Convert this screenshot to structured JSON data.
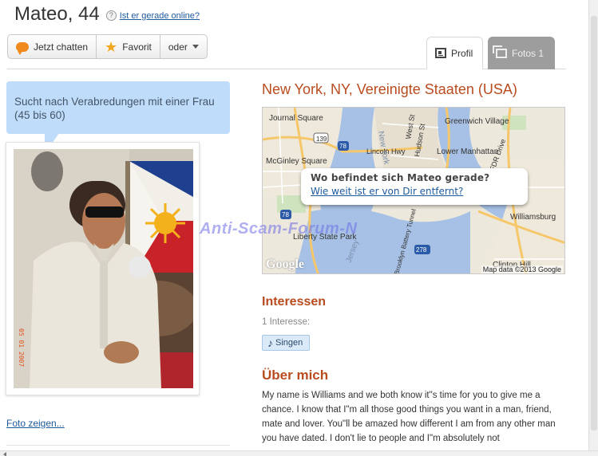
{
  "header": {
    "title": "Mateo, 44",
    "help_glyph": "?",
    "online_link": "Ist er gerade online?"
  },
  "actions": {
    "chat_label": "Jetzt chatten",
    "favorite_label": "Favorit",
    "more_label": "oder"
  },
  "tabs": [
    {
      "label": "Profil",
      "active": true
    },
    {
      "label": "Fotos 1",
      "active": false
    }
  ],
  "profile": {
    "search_text": "Sucht nach Verabredungen mit einer Frau (45 bis 60)",
    "photo_stamp": "05 01 2007",
    "photo_link": "Foto zeigen..."
  },
  "location": {
    "title": "New York, NY, Vereinigte Staaten (USA)",
    "popup_title": "Wo befindet sich Mateo gerade?",
    "popup_link": "Wie weit ist er von Dir entfernt?",
    "map_copyright": "Map data ©2013 Google",
    "map_logo": "Google",
    "map_labels": {
      "journal_square": "Journal Square",
      "greenwich_village": "Greenwich Village",
      "lower_manhattan": "Lower Manhattan",
      "mcginley_square": "McGinley Square",
      "liberty_state_park": "Liberty State Park",
      "williamsburg": "Williamsburg",
      "clinton_hill": "Clinton Hill",
      "lincoln_hwy": "Lincoln Hwy",
      "west_st": "West St",
      "hudson_st": "Hudson St",
      "fdr_drive": "FDR Drive",
      "new_york": "New York",
      "jersey": "Jersey",
      "brooklyn_battery": "Brooklyn Battery Tunnel",
      "route_139": "139",
      "route_78a": "78",
      "route_78b": "78",
      "route_278": "278"
    }
  },
  "interests": {
    "title": "Interessen",
    "count": "1 Interesse:",
    "items": [
      "Singen"
    ]
  },
  "about": {
    "title": "Über mich",
    "text": "My name is Williams and we both know it\"s time for you to give me a chance. I know that I\"m all those good things you want in a man, friend, mate and lover. You\"ll be amazed how different I am from any other man you have dated. I don't lie to people and I\"m absolutely not"
  },
  "watermark": "Anti-Scam-Forum-N",
  "colors": {
    "accent": "#b84c1f",
    "link": "#1e5a9c",
    "bubble": "#bfdcfb",
    "tab_inactive": "#9d9d9d"
  }
}
